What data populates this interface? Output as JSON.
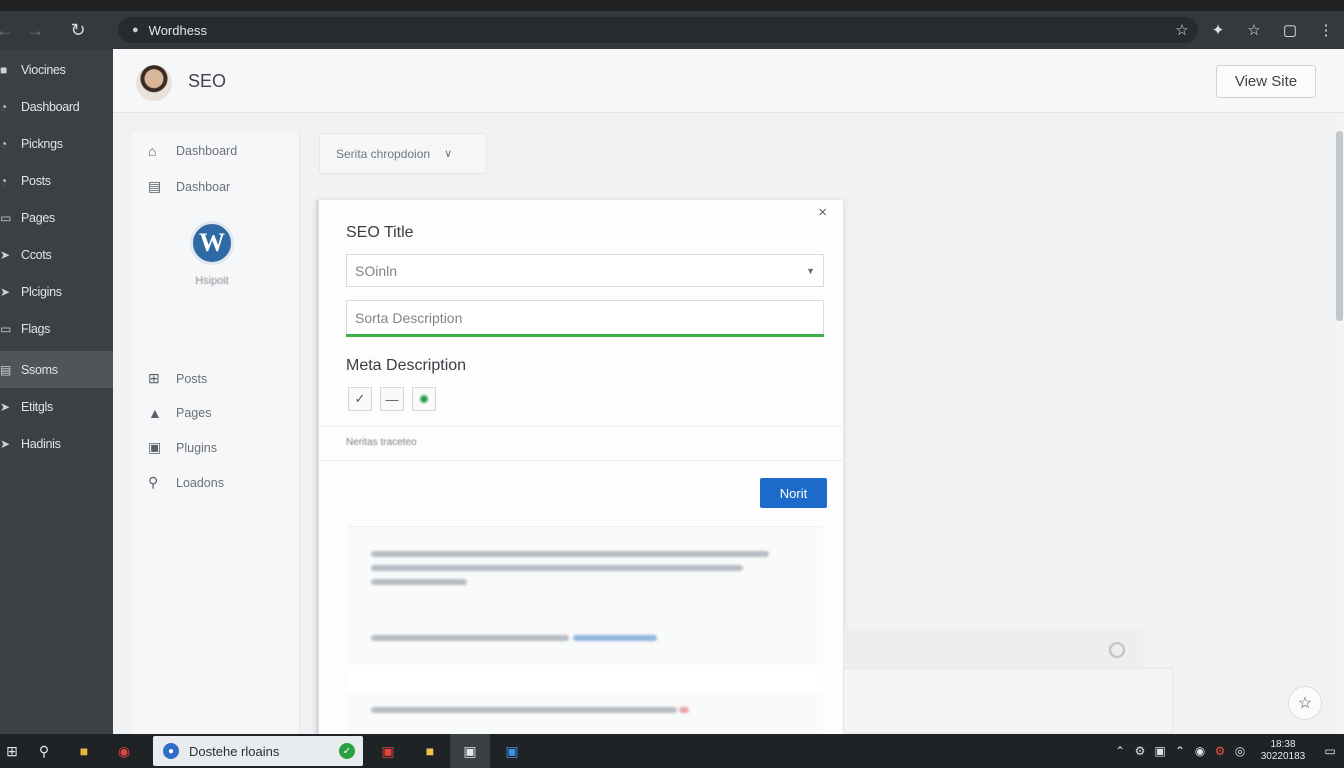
{
  "browser": {
    "url": "Wordhess",
    "icons": [
      "back-arrow-icon",
      "forward-arrow-icon",
      "reload-icon",
      "star-icon",
      "extension-icon",
      "bookmark-icon",
      "window-icon",
      "menu-kebab-icon"
    ]
  },
  "admin_menu": {
    "items": [
      {
        "label": "Viocines",
        "icon": "folder-icon",
        "active": false
      },
      {
        "label": "Dashboard",
        "icon": "gauge-icon",
        "active": false
      },
      {
        "label": "Pickngs",
        "icon": "gauge-icon",
        "active": false
      },
      {
        "label": "Posts",
        "icon": "gauge-icon",
        "active": false
      },
      {
        "label": "Pages",
        "icon": "page-icon",
        "active": false
      },
      {
        "label": "Ccots",
        "icon": "pin-icon",
        "active": false
      },
      {
        "label": "Plcigins",
        "icon": "pin-icon",
        "active": false
      },
      {
        "label": "Flags",
        "icon": "page-icon",
        "active": false
      },
      {
        "label": "Ssoms",
        "icon": "settings-icon",
        "active": true
      },
      {
        "label": "Etitgls",
        "icon": "pin-icon",
        "active": false
      },
      {
        "label": "Hadinis",
        "icon": "pin-icon",
        "active": false
      }
    ]
  },
  "header": {
    "title": "SEO",
    "view_site": "View Site"
  },
  "sub_sidebar": {
    "top_items": [
      {
        "label": "Dashboard",
        "icon": "home-icon"
      },
      {
        "label": "Dashboar",
        "icon": "lock-icon"
      }
    ],
    "logo_caption": "Hsipoit",
    "items": [
      {
        "label": "Posts",
        "icon": "plus-square-icon"
      },
      {
        "label": "Pages",
        "icon": "user-icon"
      },
      {
        "label": "Plugins",
        "icon": "plugin-icon"
      },
      {
        "label": "Loadons",
        "icon": "search-icon"
      }
    ]
  },
  "dropdown": {
    "label": "Serita chropdoion"
  },
  "modal": {
    "seo_title_label": "SEO Title",
    "seo_title_value": "SOinln",
    "description_placeholder": "Sorta Description",
    "meta_label": "Meta Description",
    "small_text": "Neritas traceteo",
    "button_label": "Norit"
  },
  "taskbar": {
    "app_title": "Dostehe rloains",
    "time": "18:38",
    "date": "30220183"
  }
}
